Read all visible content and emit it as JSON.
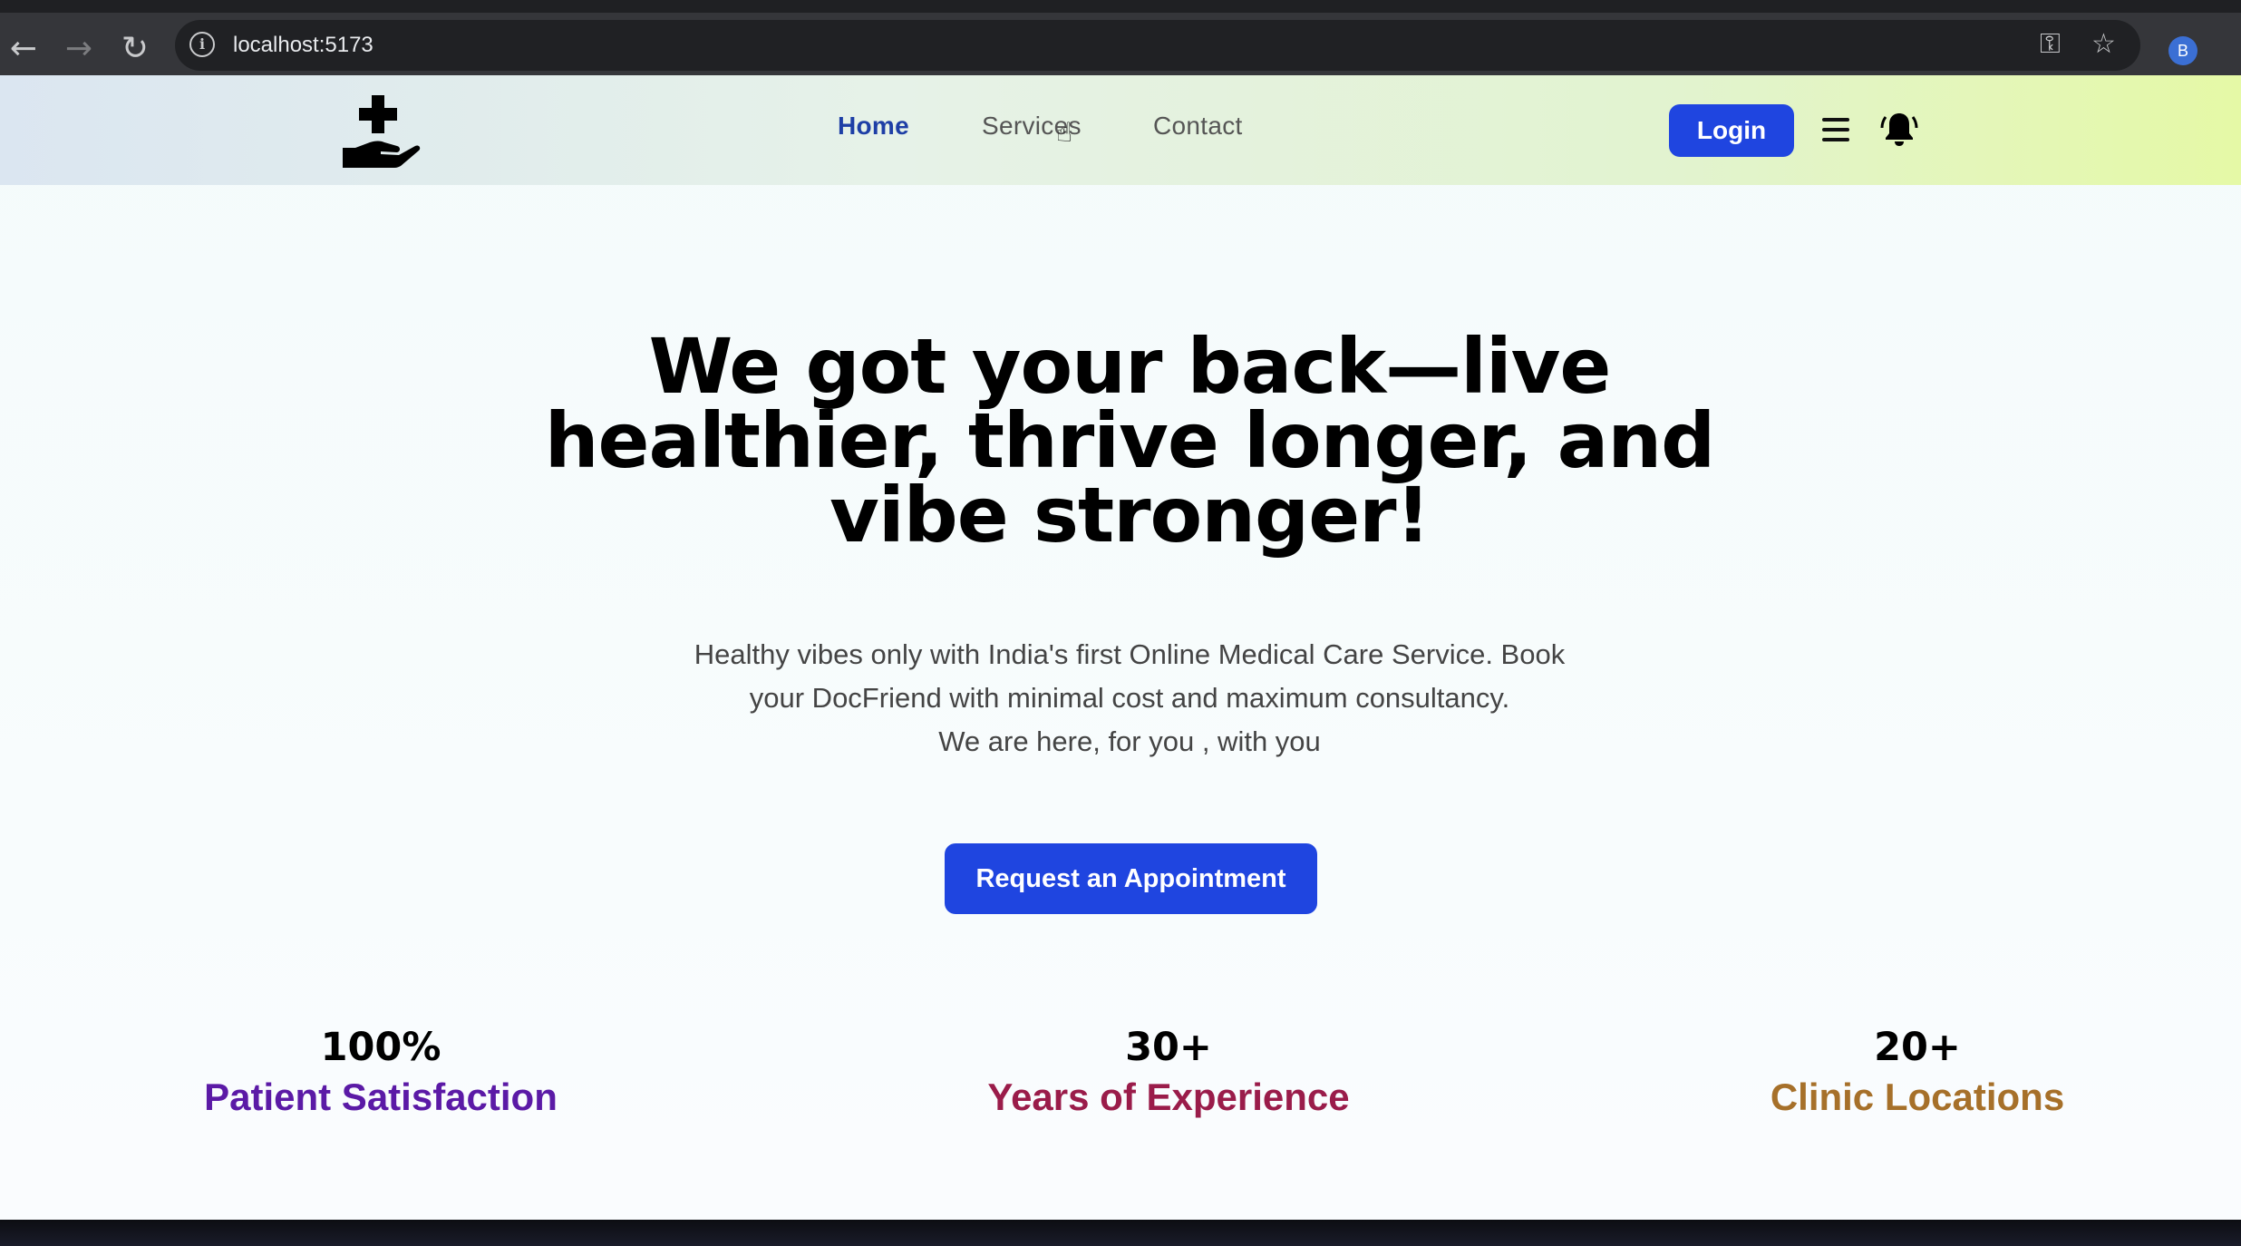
{
  "browser": {
    "back_glyph": "←",
    "forward_glyph": "→",
    "reload_glyph": "↻",
    "info_glyph": "i",
    "url": "localhost:5173",
    "key_glyph": "⚿",
    "star_glyph": "☆",
    "profile_initial": "B",
    "menu_glyph": "⋮"
  },
  "header": {
    "logo_icon": "hand-holding-medical-icon",
    "nav": {
      "home": "Home",
      "services": "Services",
      "contact": "Contact"
    },
    "login_label": "Login",
    "menu_icon": "hamburger-menu-icon",
    "bell_icon": "bell-icon"
  },
  "hero": {
    "title": "We got your back—live healthier, thrive longer, and vibe stronger!",
    "description": {
      "line1": "Healthy vibes only with India's first Online Medical Care Service. Book your DocFriend with minimal cost and maximum consultancy.",
      "line2": "We are here, for you , with you"
    },
    "cta_label": "Request an Appointment"
  },
  "stats": [
    {
      "value": "100%",
      "label": "Patient Satisfaction",
      "color": "#5b1aa6"
    },
    {
      "value": "30+",
      "label": "Years of Experience",
      "color": "#9a1c4a"
    },
    {
      "value": "20+",
      "label": "Clinic Locations",
      "color": "#a6702a"
    }
  ],
  "colors": {
    "primary": "#1f45e0",
    "nav_active": "#1e3fa6"
  }
}
